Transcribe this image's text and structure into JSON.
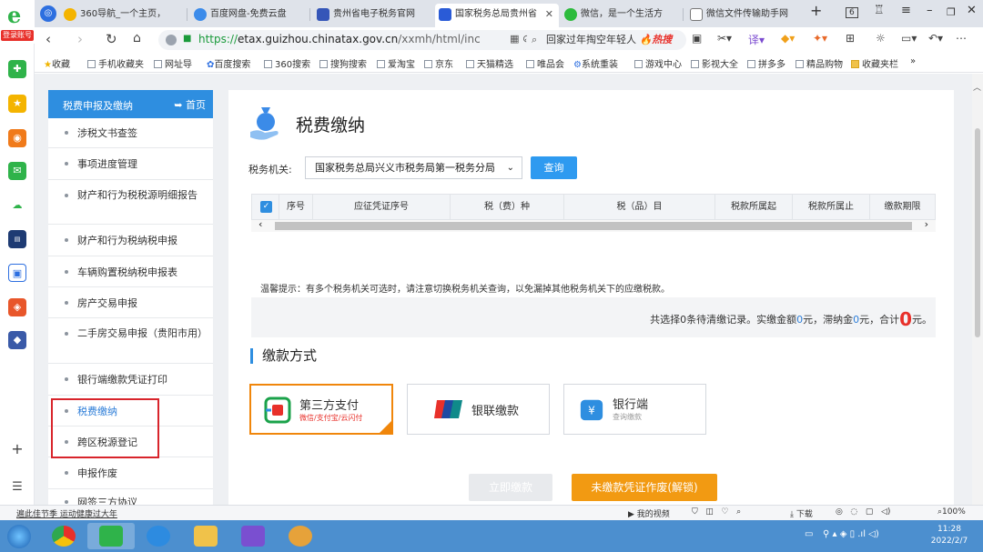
{
  "browser": {
    "app_badge": "登录账号",
    "tabs": [
      {
        "title": "360导航_一个主页，"
      },
      {
        "title": "百度网盘-免费云盘"
      },
      {
        "title": "贵州省电子税务官网"
      },
      {
        "title": "国家税务总局贵州省"
      },
      {
        "title": "微信，是一个生活方"
      },
      {
        "title": "微信文件传输助手网"
      }
    ],
    "tab_count": "6",
    "url_scheme": "https://",
    "url_host": "etax.guizhou.chinatax.gov.cn",
    "url_path": "/xxmh/html/inc",
    "search_text": "回家过年掏空年轻人",
    "search_hot": "热搜",
    "bookmarks": [
      "收藏",
      "手机收藏夹",
      "网址导",
      "百度搜索",
      "360搜索",
      "搜狗搜索",
      "爱淘宝",
      "京东",
      "天猫精选",
      "唯品会",
      "系统重装",
      "游戏中心",
      "影视大全",
      "拼多多",
      "精品购物",
      "收藏夹栏",
      "»"
    ]
  },
  "sidebar": {
    "header_title": "税费申报及缴纳",
    "home_label": "首页",
    "items": [
      {
        "label": "涉税文书查签"
      },
      {
        "label": "事项进度管理"
      },
      {
        "label": "财产和行为税税源明细报告"
      },
      {
        "label": "财产和行为税纳税申报"
      },
      {
        "label": "车辆购置税纳税申报表"
      },
      {
        "label": "房产交易申报"
      },
      {
        "label": "二手房交易申报（贵阳市用）"
      },
      {
        "label": "银行端缴款凭证打印"
      },
      {
        "label": "税费缴纳"
      },
      {
        "label": "跨区税源登记"
      },
      {
        "label": "申报作废"
      },
      {
        "label": "网签三方协议"
      }
    ]
  },
  "main": {
    "title": "税费缴纳",
    "tax_office_label": "税务机关:",
    "tax_office_value": "国家税务总局兴义市税务局第一税务分局",
    "query_button": "查询",
    "table_headers": [
      "序号",
      "应征凭证序号",
      "税（费）种",
      "税（品）目",
      "税款所属起",
      "税款所属止",
      "缴款期限"
    ],
    "tip": "温馨提示：有多个税务机关可选时，请注意切换税务机关查询，以免漏掉其他税务机关下的应缴税款。",
    "summary": {
      "prefix": "共选择0条待清缴记录。实缴金额",
      "paid": "0",
      "mid1": "元，滞纳金",
      "late_fee": "0",
      "mid2": "元，合计",
      "total": "0",
      "suffix": "元。"
    },
    "payment_section_title": "缴款方式",
    "payment_methods": [
      {
        "title": "第三方支付",
        "subtitle": "微信/支付宝/云闪付"
      },
      {
        "title": "银联缴款",
        "subtitle": ""
      },
      {
        "title": "银行端",
        "subtitle": "查询缴款"
      }
    ],
    "pay_now_button": "立即缴款",
    "void_button": "未缴款凭证作废(解锁)"
  },
  "statusbar": {
    "left_text": "遍此佳节季 运动健康过大年",
    "items": [
      "我的视频",
      "下载"
    ],
    "zoom": "100%"
  },
  "taskbar": {
    "time": "11:28",
    "date": "2022/2/7"
  }
}
